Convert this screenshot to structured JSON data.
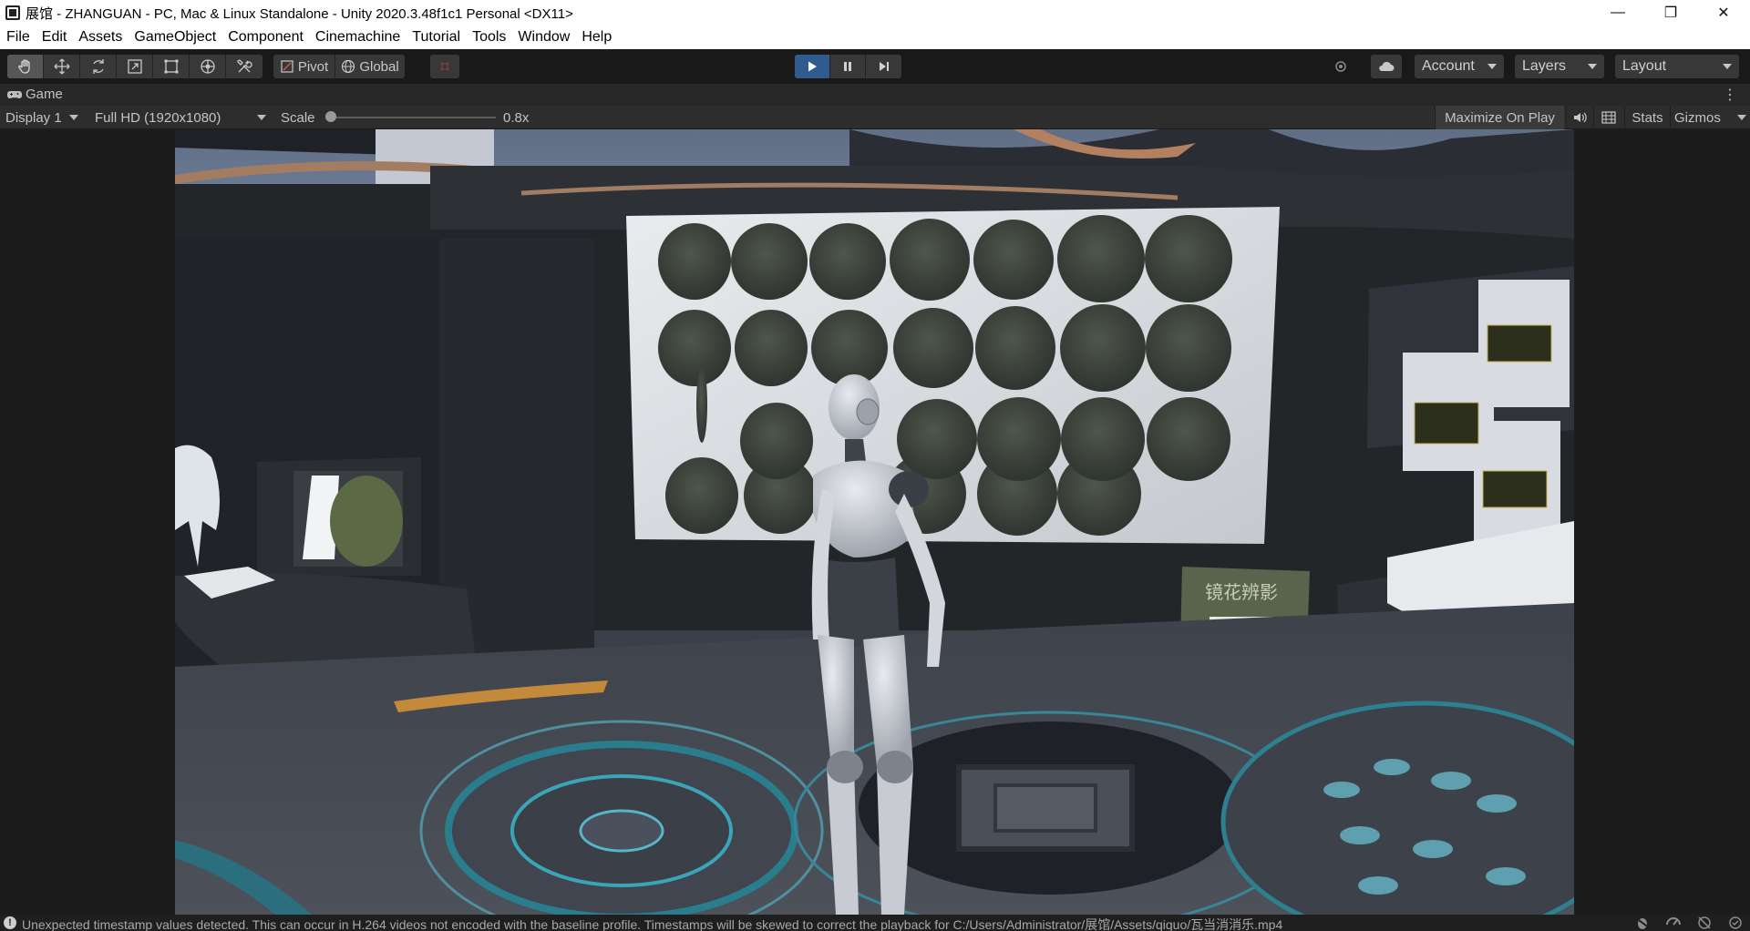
{
  "window": {
    "title": "展馆 - ZHANGUAN - PC, Mac & Linux Standalone - Unity 2020.3.48f1c1 Personal <DX11>",
    "minimize_glyph": "—",
    "maximize_glyph": "❐",
    "close_glyph": "✕"
  },
  "menu": {
    "items": [
      "File",
      "Edit",
      "Assets",
      "GameObject",
      "Component",
      "Cinemachine",
      "Tutorial",
      "Tools",
      "Window",
      "Help"
    ]
  },
  "toolbar": {
    "tools": [
      {
        "name": "hand-tool",
        "icon": "hand-icon",
        "active": true
      },
      {
        "name": "move-tool",
        "icon": "move-icon"
      },
      {
        "name": "rotate-tool",
        "icon": "rotate-icon"
      },
      {
        "name": "scale-tool",
        "icon": "scale-icon"
      },
      {
        "name": "rect-tool",
        "icon": "rect-icon"
      },
      {
        "name": "transform-tool",
        "icon": "transform-icon"
      },
      {
        "name": "custom-tool",
        "icon": "tools-icon"
      }
    ],
    "pivot_label": "Pivot",
    "global_label": "Global",
    "account_label": "Account",
    "layers_label": "Layers",
    "layout_label": "Layout",
    "accent_color": "#2f5b8f"
  },
  "game_tab": {
    "label": "Game"
  },
  "game_view": {
    "display": "Display 1",
    "resolution": "Full HD (1920x1080)",
    "scale_label": "Scale",
    "scale_value": "0.8x",
    "maximize_on_play": "Maximize On Play",
    "stats": "Stats",
    "gizmos": "Gizmos"
  },
  "scene": {
    "sign_text": "镜花辨影"
  },
  "status": {
    "message": "Unexpected timestamp values detected. This can occur in H.264 videos not encoded with the baseline profile. Timestamps will be skewed to correct the playback for C:/Users/Administrator/展馆/Assets/qiquo/瓦当消消乐.mp4"
  }
}
